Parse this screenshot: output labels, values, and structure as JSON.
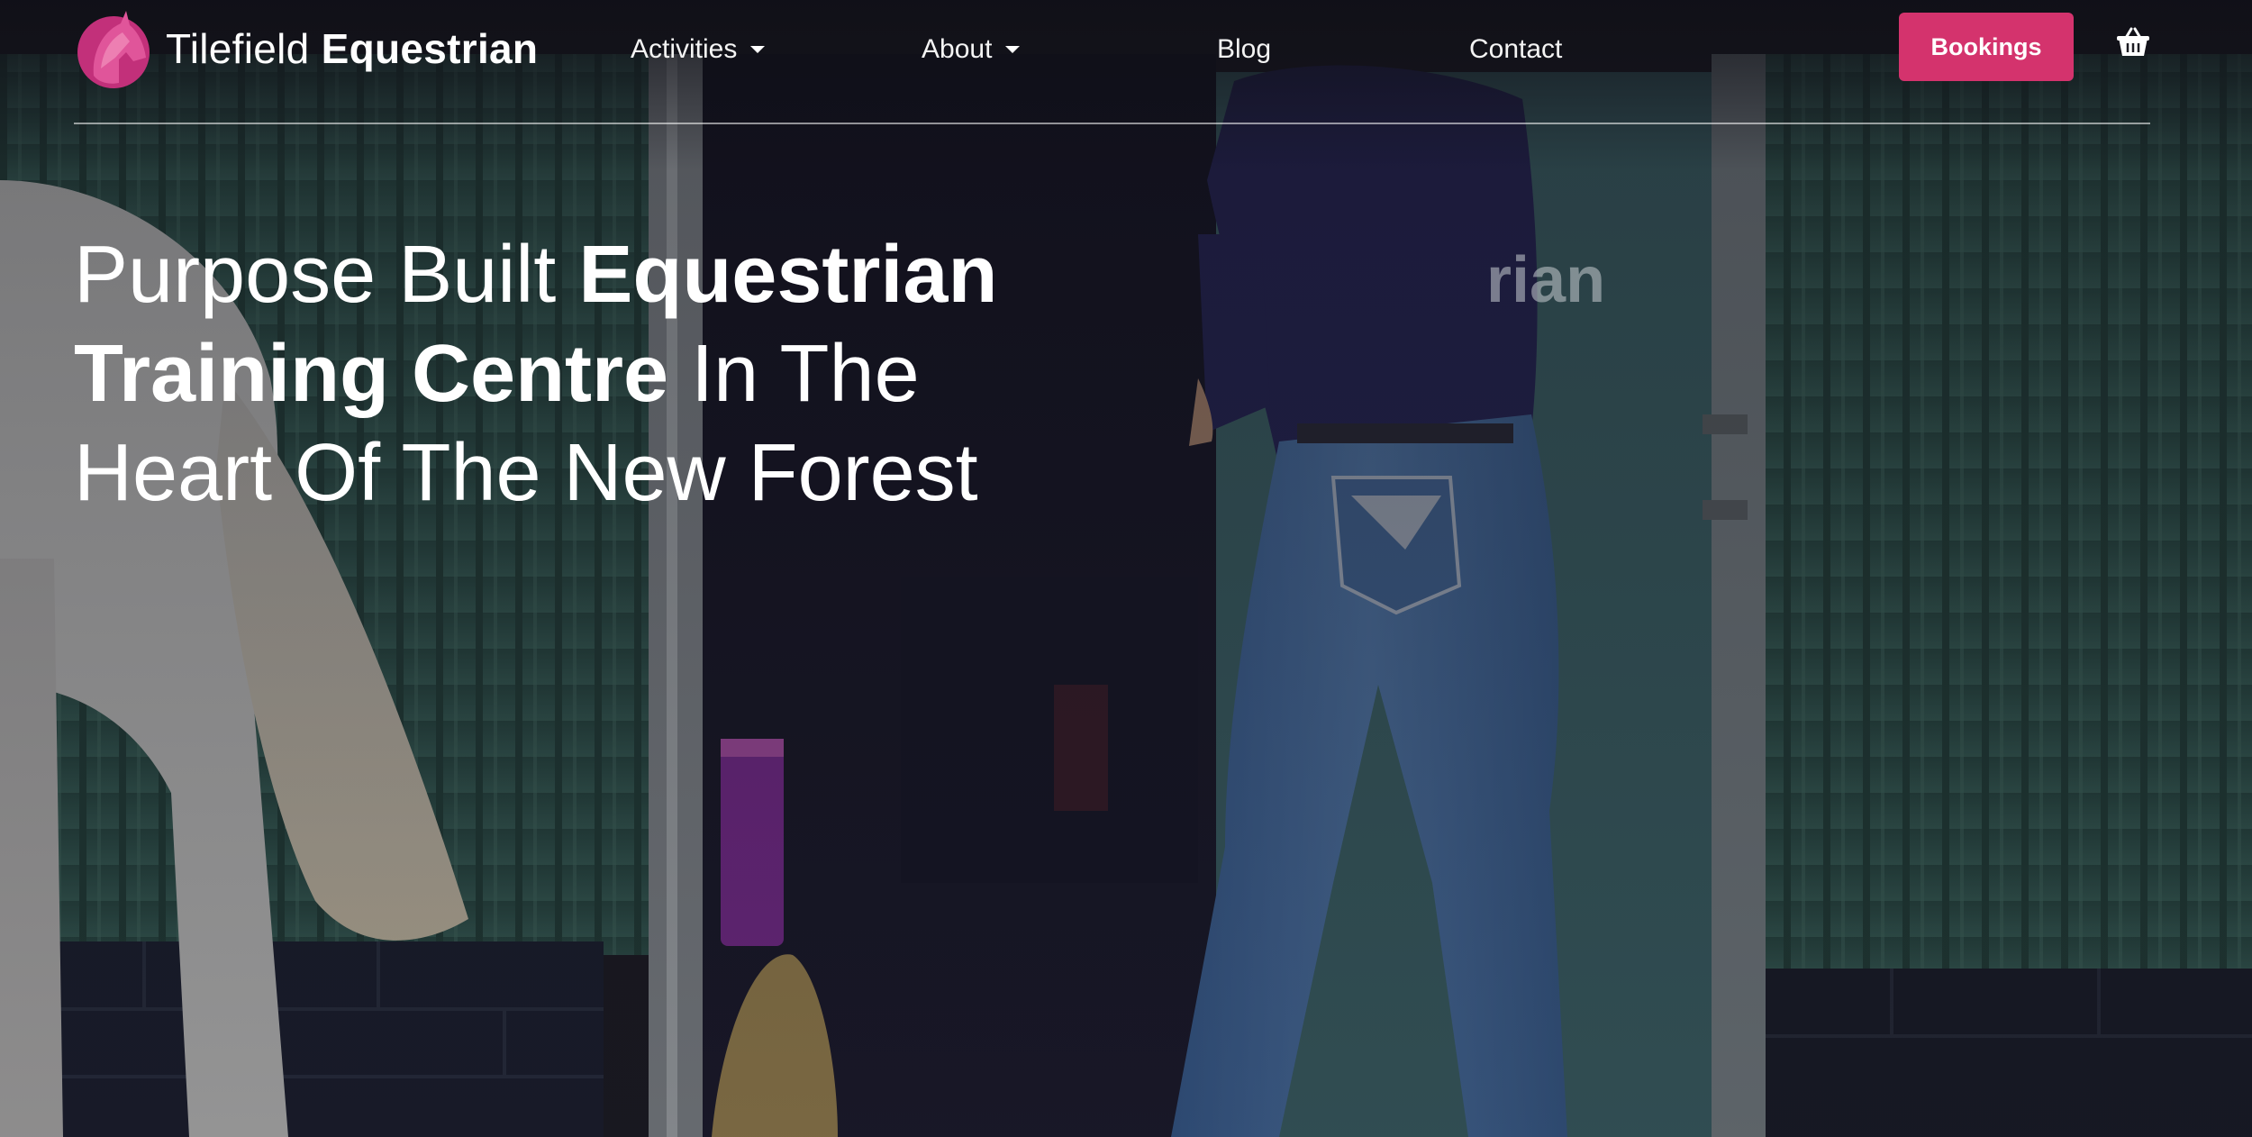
{
  "brand": {
    "name_light": "Tilefield",
    "name_bold": "Equestrian",
    "logo_icon": "horse-head-icon",
    "accent_color": "#d4336d"
  },
  "nav": {
    "items": [
      {
        "label": "Activities",
        "has_dropdown": true
      },
      {
        "label": "About",
        "has_dropdown": true
      },
      {
        "label": "Blog",
        "has_dropdown": false
      },
      {
        "label": "Contact",
        "has_dropdown": false
      }
    ],
    "bookings_label": "Bookings",
    "cart_icon": "basket-icon"
  },
  "hero": {
    "line1_light": "Purpose Built ",
    "line1_bold": "Equestrian",
    "line2_bold": "Training Centre",
    "line2_light": " In The",
    "line3_light": "Heart Of The New Forest",
    "background_word": "rian"
  }
}
